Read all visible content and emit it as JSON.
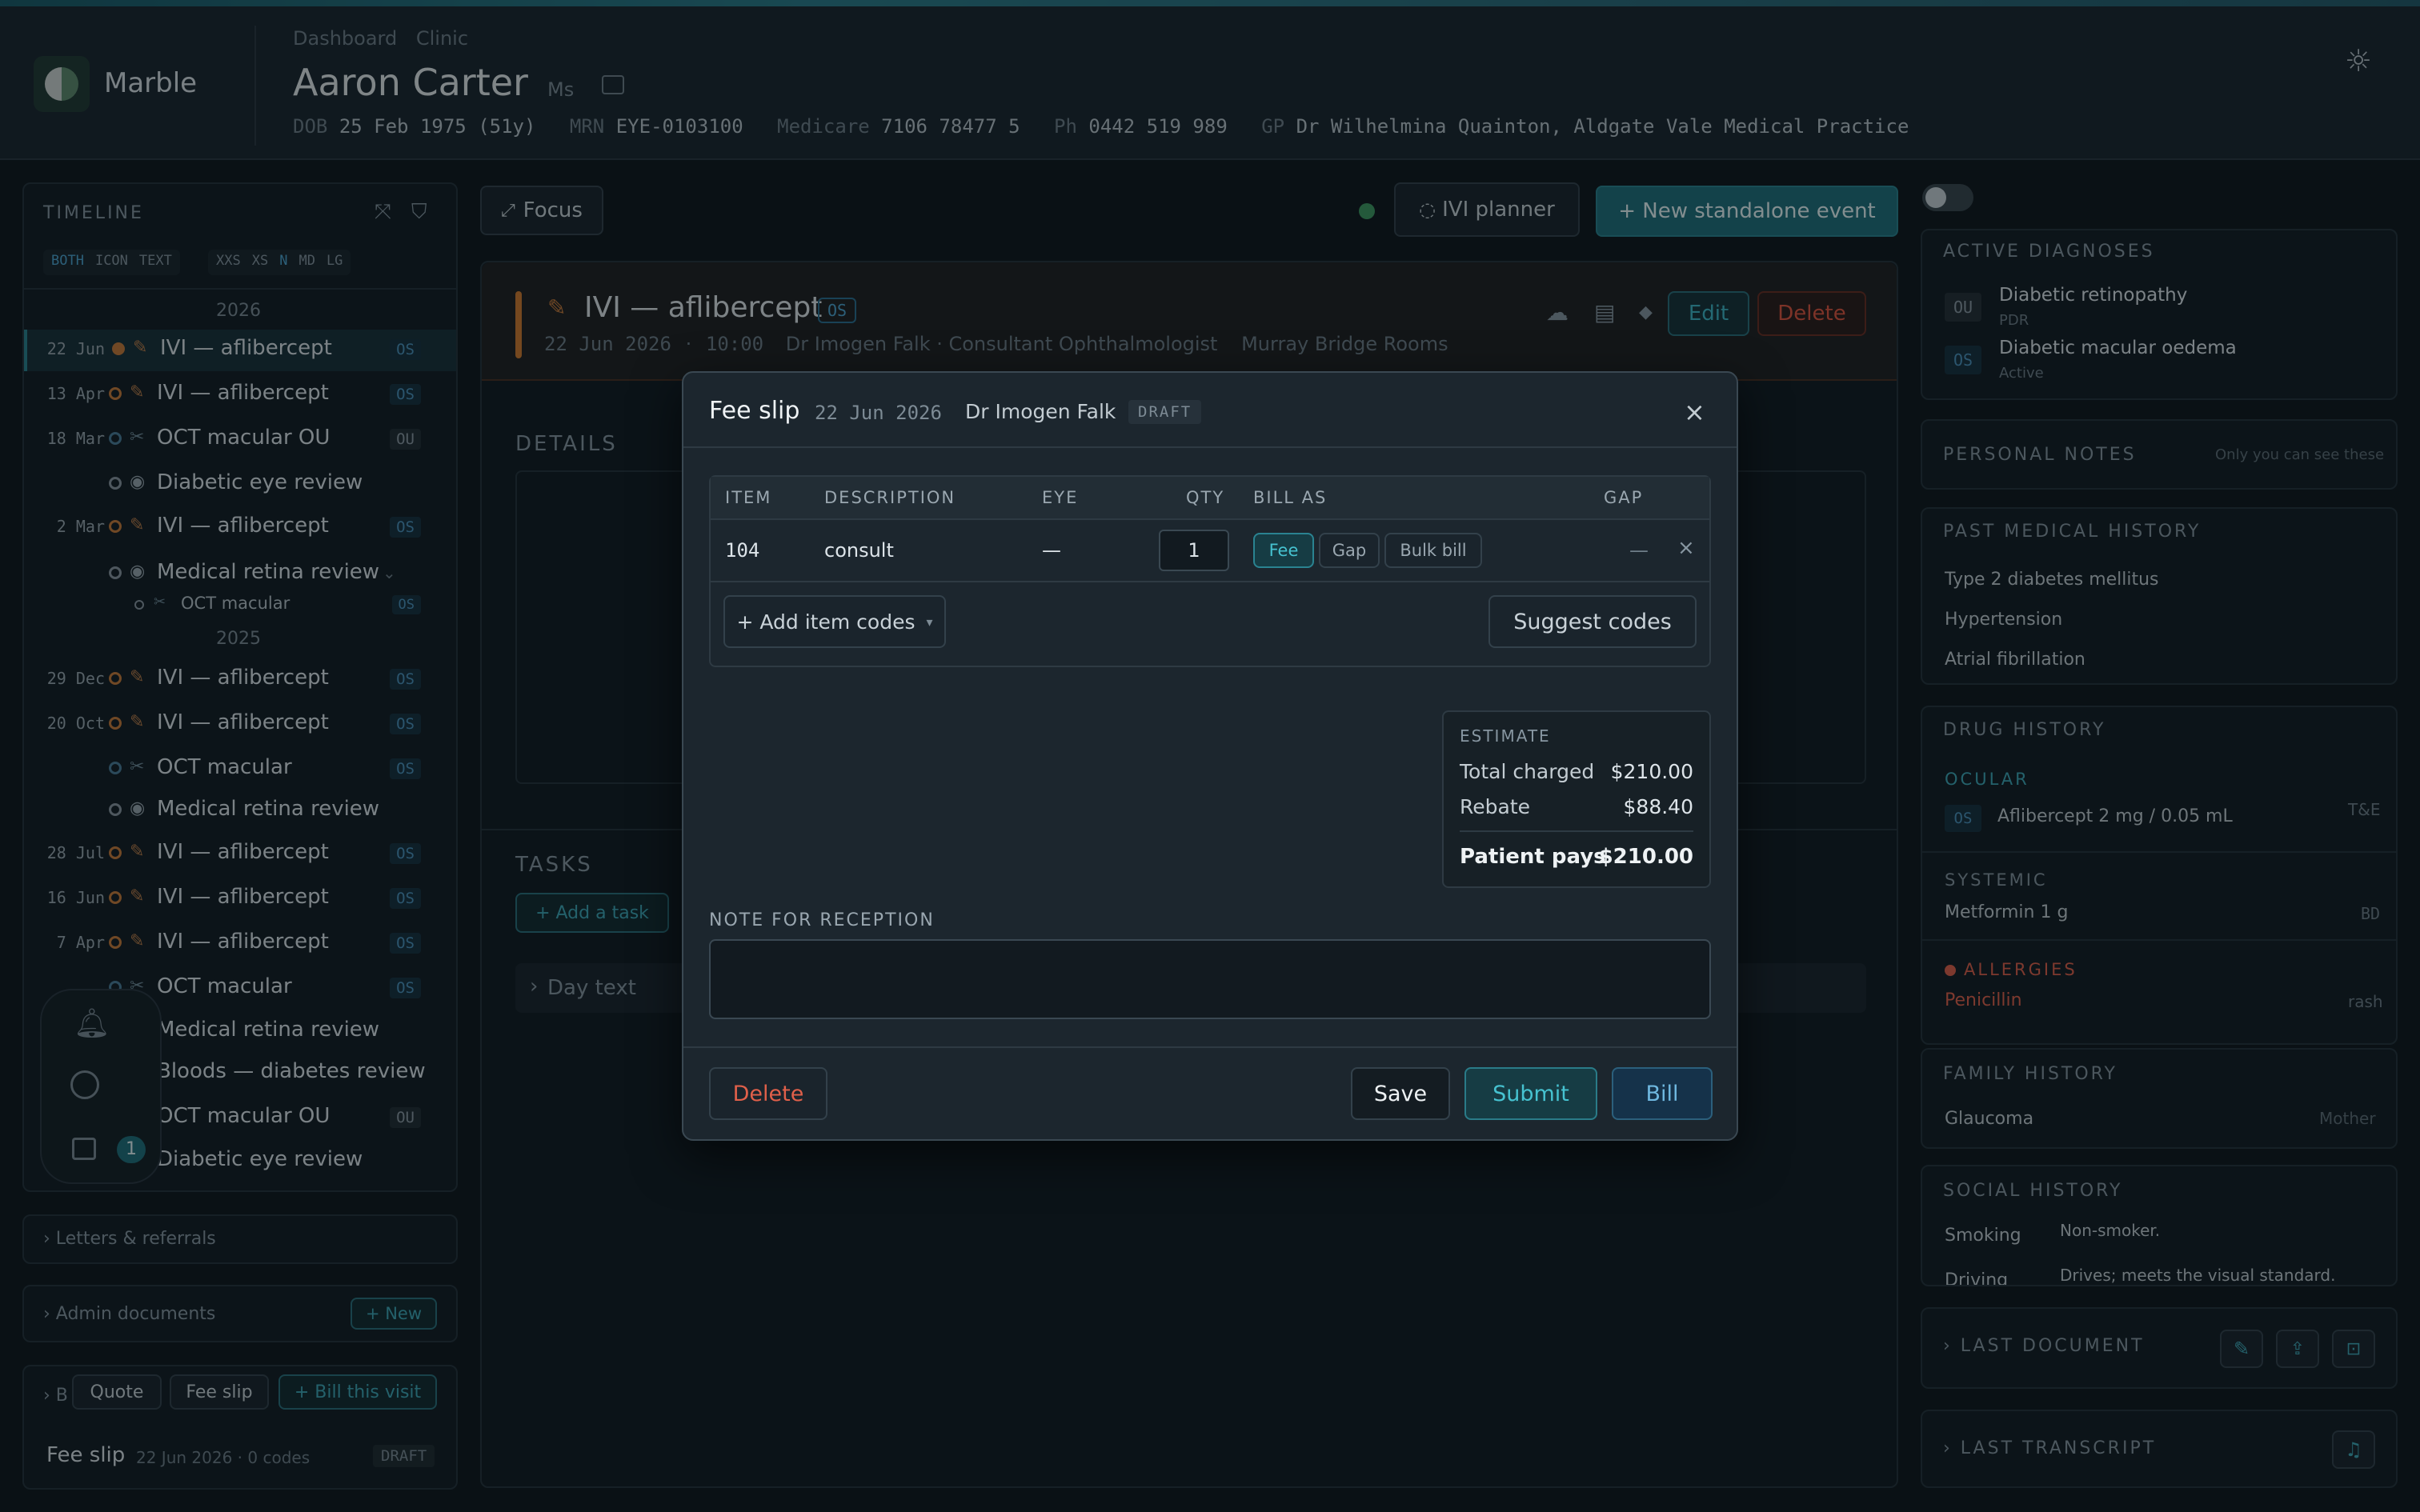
{
  "app": {
    "name": "Marble"
  },
  "breadcrumb": {
    "item1": "Dashboard",
    "item2": "Clinic"
  },
  "patient": {
    "name": "Aaron Carter",
    "title": "Ms",
    "dob_label": "DOB",
    "dob": "25 Feb 1975 (51y)",
    "mrn_label": "MRN",
    "mrn": "EYE-0103100",
    "medicare_label": "Medicare",
    "medicare": "7106 78477 5",
    "ph_label": "Ph",
    "ph": "0442 519 989",
    "gp_label": "GP",
    "gp": "Dr Wilhelmina Quainton, Aldgate Vale Medical Practice"
  },
  "timeline": {
    "title": "TIMELINE",
    "modes": [
      "BOTH",
      "ICON",
      "TEXT"
    ],
    "sizes": [
      "XXS",
      "XS",
      "N",
      "MD",
      "LG"
    ],
    "year1": "2026",
    "year2": "2025",
    "rows": [
      {
        "date": "22 Jun",
        "label": "IVI — aflibercept",
        "tag": "OS"
      },
      {
        "date": "13 Apr",
        "label": "IVI — aflibercept",
        "tag": "OS"
      },
      {
        "date": "18 Mar",
        "label": "OCT macular OU",
        "tag": "OU"
      },
      {
        "date": "",
        "label": "Diabetic eye review",
        "tag": ""
      },
      {
        "date": "2 Mar",
        "label": "IVI — aflibercept",
        "tag": "OS"
      },
      {
        "date": "",
        "label": "Medical retina review",
        "tag": ""
      },
      {
        "date": "",
        "label": "OCT macular",
        "tag": "OS"
      },
      {
        "date": "29 Dec",
        "label": "IVI — aflibercept",
        "tag": "OS"
      },
      {
        "date": "20 Oct",
        "label": "IVI — aflibercept",
        "tag": "OS"
      },
      {
        "date": "",
        "label": "OCT macular",
        "tag": "OS"
      },
      {
        "date": "",
        "label": "Medical retina review",
        "tag": ""
      },
      {
        "date": "28 Jul",
        "label": "IVI — aflibercept",
        "tag": "OS"
      },
      {
        "date": "16 Jun",
        "label": "IVI — aflibercept",
        "tag": "OS"
      },
      {
        "date": "7 Apr",
        "label": "IVI — aflibercept",
        "tag": "OS"
      },
      {
        "date": "",
        "label": "OCT macular",
        "tag": "OS"
      },
      {
        "date": "",
        "label": "Medical retina review",
        "tag": ""
      },
      {
        "date": "",
        "label": "Bloods — diabetes review",
        "tag": ""
      },
      {
        "date": "",
        "label": "OCT macular OU",
        "tag": "OU"
      },
      {
        "date": "",
        "label": "Diabetic eye review",
        "tag": ""
      }
    ],
    "badge_count": "1"
  },
  "left_sections": {
    "letters": "Letters & referrals",
    "admin": "Admin documents",
    "admin_new": "+ New",
    "billing_prefix": "B",
    "quote": "Quote",
    "fee_slip_btn": "Fee slip",
    "bill_visit": "+ Bill this visit",
    "fee_slip_label": "Fee slip",
    "fee_slip_meta": "22 Jun 2026 · 0 codes",
    "fee_slip_status": "DRAFT"
  },
  "toolbar": {
    "focus": "Focus",
    "ivi_planner": "IVI planner",
    "new_event": "+ New standalone event"
  },
  "event": {
    "title": "IVI — aflibercept",
    "eye": "OS",
    "date": "22 Jun 2026",
    "time": "10:00",
    "clinician": "Dr Imogen Falk · Consultant Ophthalmologist",
    "location": "Murray Bridge Rooms",
    "edit": "Edit",
    "delete": "Delete",
    "details_title": "DETAILS",
    "tasks_title": "TASKS",
    "add_task": "+ Add a task",
    "day_text": "Day text"
  },
  "modal": {
    "title": "Fee slip",
    "date": "22 Jun 2026",
    "doctor": "Dr Imogen Falk",
    "status": "DRAFT",
    "columns": {
      "item": "ITEM",
      "description": "DESCRIPTION",
      "eye": "EYE",
      "qty": "QTY",
      "bill_as": "BILL AS",
      "gap": "GAP"
    },
    "row": {
      "item": "104",
      "description": "consult",
      "eye": "—",
      "qty": "1",
      "gap": "—"
    },
    "bill_options": [
      "Fee",
      "Gap",
      "Bulk bill"
    ],
    "add_codes": "+ Add item codes",
    "suggest_codes": "Suggest codes",
    "estimate": {
      "title": "ESTIMATE",
      "total_label": "Total charged",
      "total": "$210.00",
      "rebate_label": "Rebate",
      "rebate": "$88.40",
      "pays_label": "Patient pays",
      "pays": "$210.00"
    },
    "note_label": "NOTE FOR RECEPTION",
    "note_value": "",
    "delete": "Delete",
    "save": "Save",
    "submit": "Submit",
    "bill": "Bill"
  },
  "right": {
    "active_diagnoses": "ACTIVE DIAGNOSES",
    "diag": [
      {
        "eye": "OU",
        "name": "Diabetic retinopathy",
        "sub": "PDR"
      },
      {
        "eye": "OS",
        "name": "Diabetic macular oedema",
        "sub": "Active"
      }
    ],
    "personal_notes": "PERSONAL NOTES",
    "personal_notes_hint": "Only you can see these",
    "pmh_title": "PAST MEDICAL HISTORY",
    "pmh": [
      "Type 2 diabetes mellitus",
      "Hypertension",
      "Atrial fibrillation"
    ],
    "drug_title": "DRUG HISTORY",
    "ocular_label": "OCULAR",
    "ocular_eye": "OS",
    "ocular_drug": "Aflibercept 2 mg / 0.05 mL",
    "ocular_freq": "T&E",
    "systemic_label": "SYSTEMIC",
    "systemic_drug": "Metformin 1 g",
    "systemic_freq": "BD",
    "allergies_label": "ALLERGIES",
    "allergy": "Penicillin",
    "allergy_reaction": "rash",
    "family_title": "FAMILY HISTORY",
    "family_item": "Glaucoma",
    "family_rel": "Mother",
    "social_title": "SOCIAL HISTORY",
    "smoking_label": "Smoking",
    "smoking_value": "Non-smoker.",
    "driving_label": "Driving",
    "driving_value": "Drives; meets the visual standard.",
    "last_document": "LAST DOCUMENT",
    "last_transcript": "LAST TRANSCRIPT"
  }
}
